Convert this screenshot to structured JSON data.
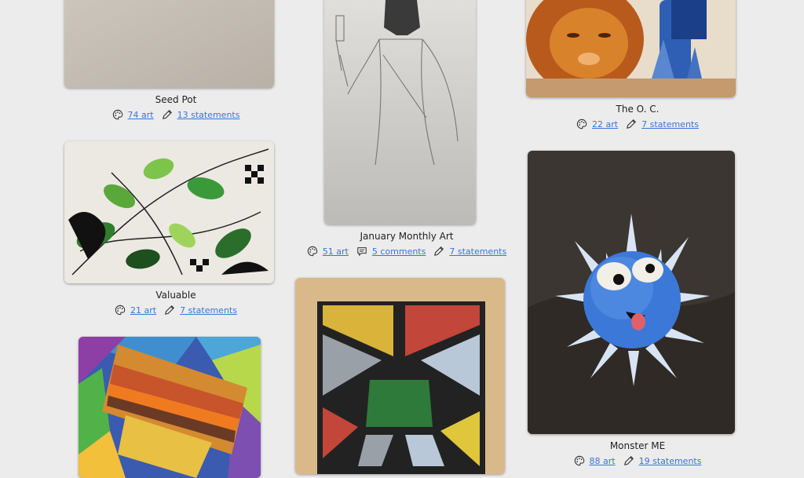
{
  "cards": [
    {
      "title": "Seed Pot",
      "art": "74 art",
      "statements": "13 statements"
    },
    {
      "title": "January Monthly Art",
      "art": "51 art",
      "comments": "5 comments",
      "statements": "7 statements"
    },
    {
      "title": "The O. C.",
      "art": "22 art",
      "statements": "7 statements"
    },
    {
      "title": "Valuable",
      "art": "21 art",
      "statements": "7 statements"
    },
    {
      "title": "Monster ME",
      "art": "88 art",
      "statements": "19 statements"
    }
  ],
  "icons": {
    "art": "palette-icon",
    "comments": "speech-bubble-icon",
    "statements": "pencil-icon"
  },
  "colors": {
    "link": "#3b73d9",
    "background": "#ececec"
  }
}
